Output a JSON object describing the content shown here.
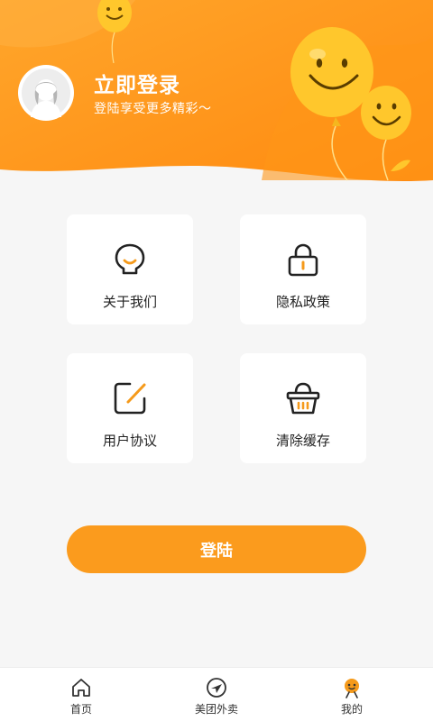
{
  "header": {
    "title": "立即登录",
    "subtitle": "登陆享受更多精彩～"
  },
  "menu": [
    {
      "label": "关于我们",
      "icon": "lightbulb-icon"
    },
    {
      "label": "隐私政策",
      "icon": "lock-icon"
    },
    {
      "label": "用户协议",
      "icon": "edit-icon"
    },
    {
      "label": "清除缓存",
      "icon": "basket-icon"
    }
  ],
  "login_button": "登陆",
  "tabs": [
    {
      "label": "首页",
      "icon": "home-icon"
    },
    {
      "label": "美团外卖",
      "icon": "compass-icon"
    },
    {
      "label": "我的",
      "icon": "smiley-user-icon"
    }
  ],
  "colors": {
    "accent": "#fb9b1d",
    "header_orange": "#ff9a1f",
    "balloon_yellow": "#ffc72c",
    "icon_orange": "#f59a1b"
  }
}
